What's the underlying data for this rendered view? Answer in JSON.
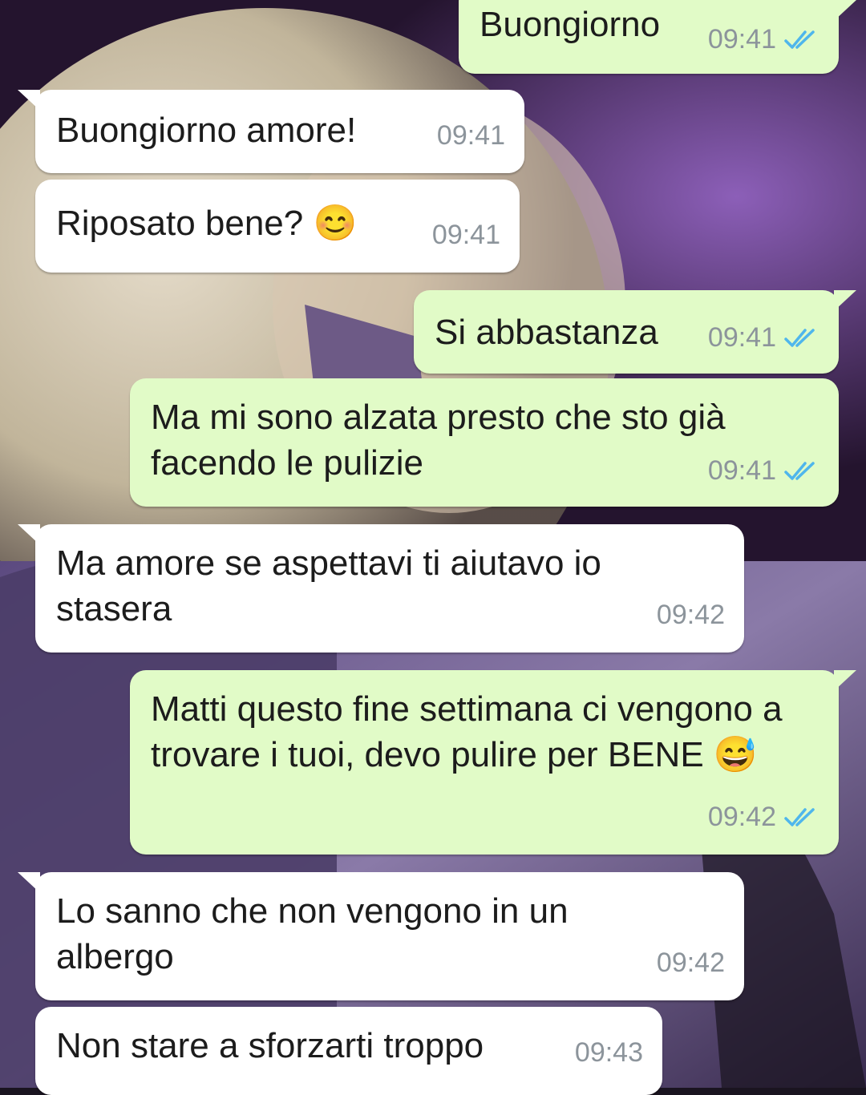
{
  "chat": {
    "messages": [
      {
        "dir": "out",
        "text": "Buongiorno",
        "time": "09:41",
        "read": true
      },
      {
        "dir": "in",
        "text": "Buongiorno amore!",
        "time": "09:41"
      },
      {
        "dir": "in",
        "text": "Riposato bene? 😊",
        "time": "09:41"
      },
      {
        "dir": "out",
        "text": "Si abbastanza",
        "time": "09:41",
        "read": true
      },
      {
        "dir": "out",
        "text": "Ma mi sono alzata presto che sto già facendo le pulizie",
        "time": "09:41",
        "read": true
      },
      {
        "dir": "in",
        "text": "Ma amore se aspettavi ti aiutavo io stasera",
        "time": "09:42"
      },
      {
        "dir": "out",
        "text": "Matti questo fine settimana ci vengono a trovare i tuoi, devo pulire per BENE 😅",
        "time": "09:42",
        "read": true
      },
      {
        "dir": "in",
        "text": "Lo sanno che non vengono in un albergo",
        "time": "09:42"
      },
      {
        "dir": "in",
        "text": "Non stare a sforzarti troppo",
        "time": "09:43"
      }
    ]
  },
  "colors": {
    "incoming_bubble": "#ffffff",
    "outgoing_bubble": "#e1fbc7",
    "read_ticks": "#4fb6ec",
    "timestamp": "#8c949b"
  }
}
